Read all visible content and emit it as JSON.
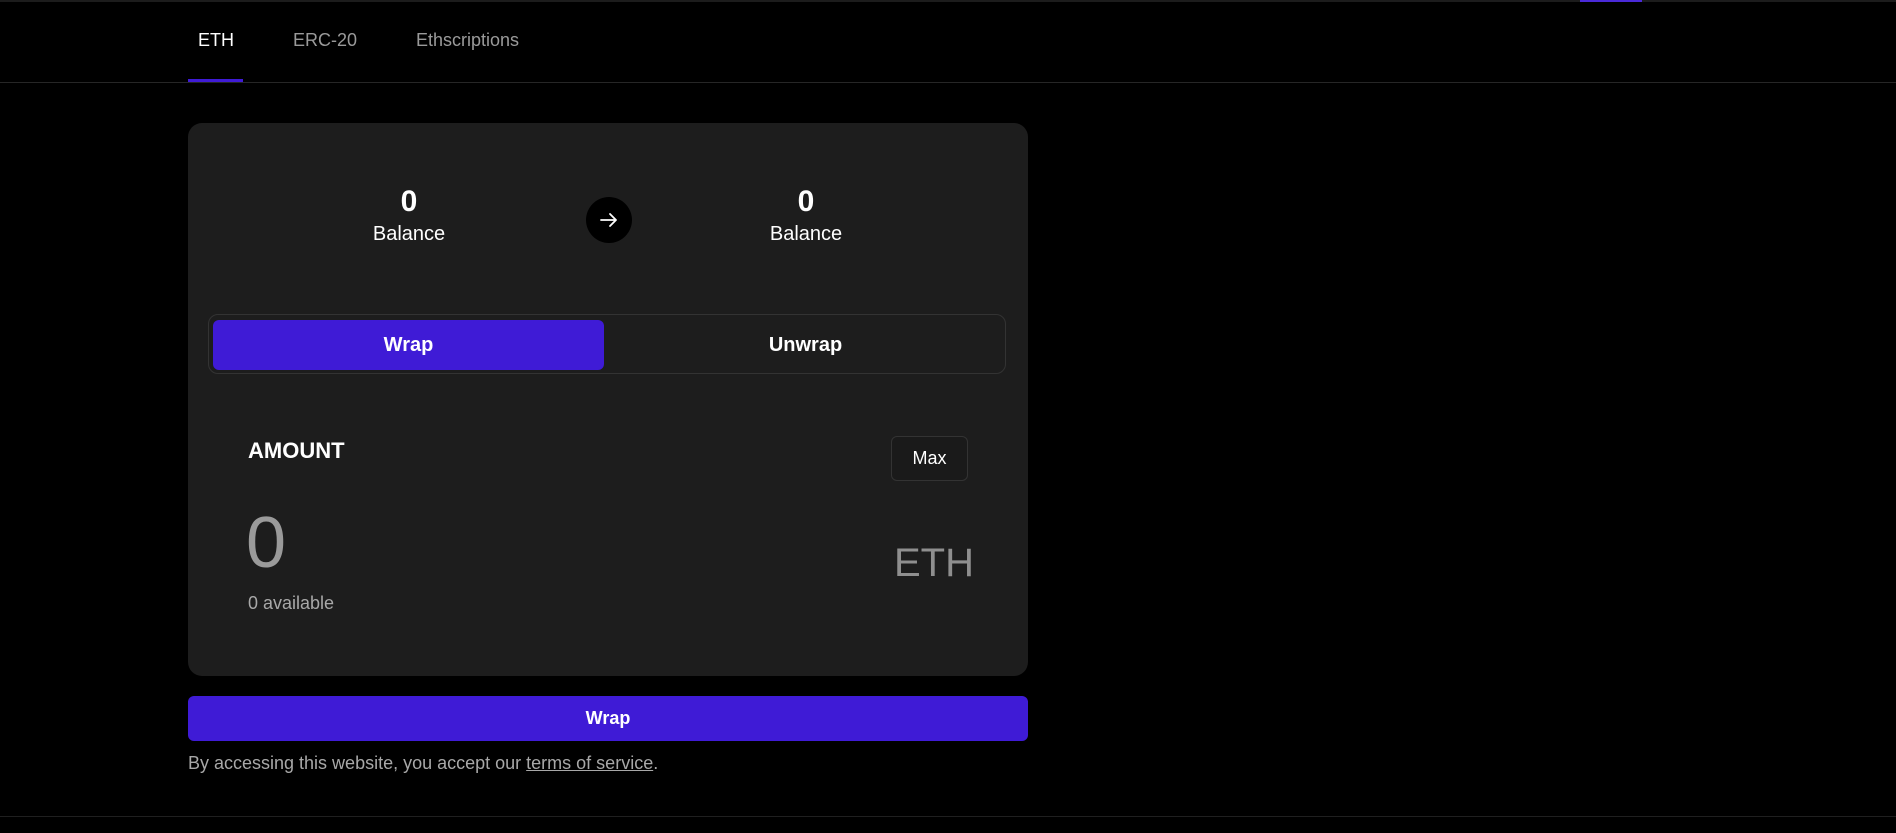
{
  "tabs": [
    {
      "label": "ETH",
      "active": true
    },
    {
      "label": "ERC-20",
      "active": false
    },
    {
      "label": "Ethscriptions",
      "active": false
    }
  ],
  "balances": {
    "from": {
      "value": "0",
      "label": "Balance"
    },
    "to": {
      "value": "0",
      "label": "Balance"
    },
    "arrow_icon": "arrow-right-icon"
  },
  "mode_toggle": {
    "options": [
      "Wrap",
      "Unwrap"
    ],
    "selected": "Wrap"
  },
  "amount": {
    "label": "AMOUNT",
    "max_label": "Max",
    "value": "0",
    "currency": "ETH",
    "available": "0 available"
  },
  "action_button": "Wrap",
  "footer": {
    "prefix": "By accessing this website, you accept our ",
    "link": "terms of service",
    "suffix": "."
  },
  "colors": {
    "accent": "#3f1bd6",
    "background": "#000000",
    "card": "#1d1d1d"
  }
}
